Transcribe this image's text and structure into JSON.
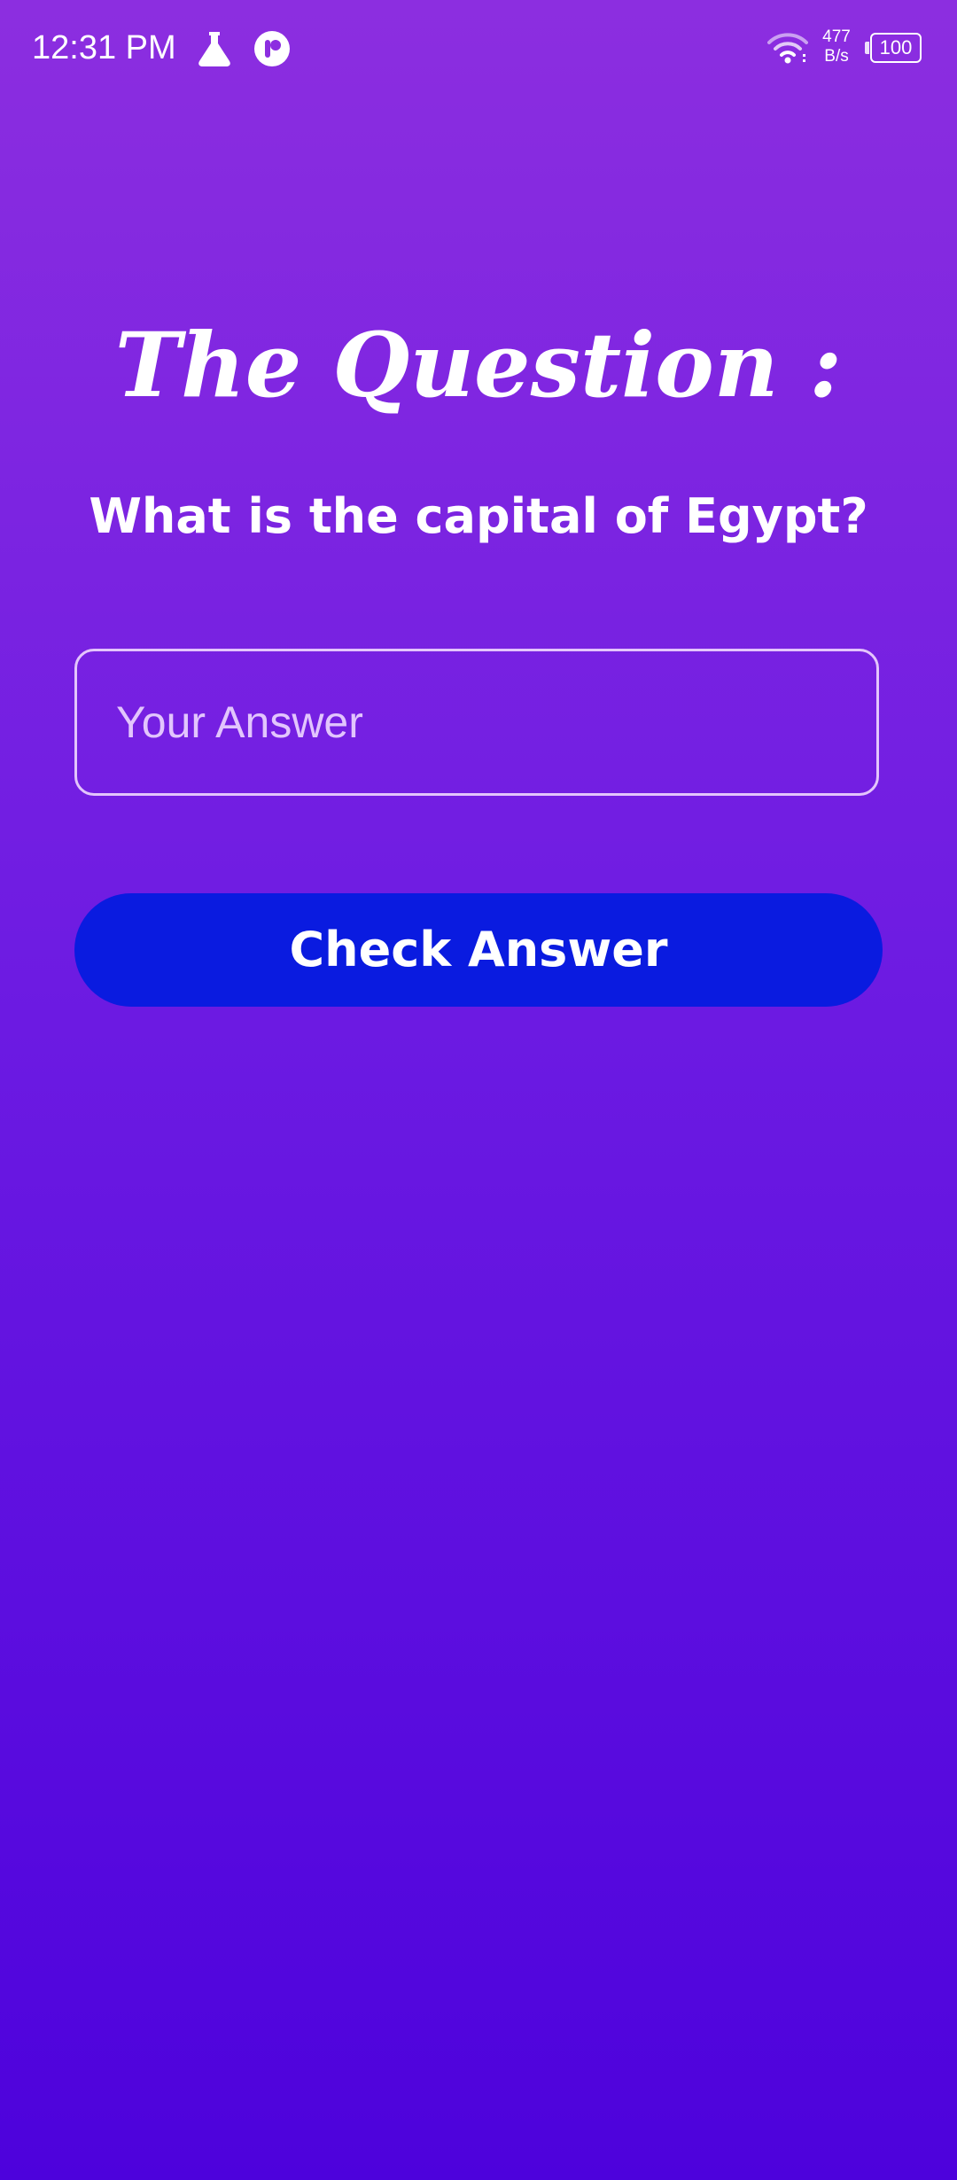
{
  "status_bar": {
    "time": "12:31 PM",
    "left_icons": [
      "flask-icon",
      "app-badge-icon"
    ],
    "right_icons": [
      "wifi-icon",
      "battery-icon"
    ],
    "net_speed_value": "477",
    "net_speed_unit": "B/s",
    "battery_level": "100"
  },
  "quiz": {
    "heading": "The Question :",
    "question": "What is the capital of Egypt?",
    "answer_placeholder": "Your Answer",
    "answer_value": "",
    "check_button_label": "Check Answer"
  },
  "colors": {
    "background_top": "#8c2ee0",
    "background_bottom": "#4d02dc",
    "button": "#0a1be0",
    "field_border": "#f0d7ff",
    "text": "#ffffff"
  }
}
